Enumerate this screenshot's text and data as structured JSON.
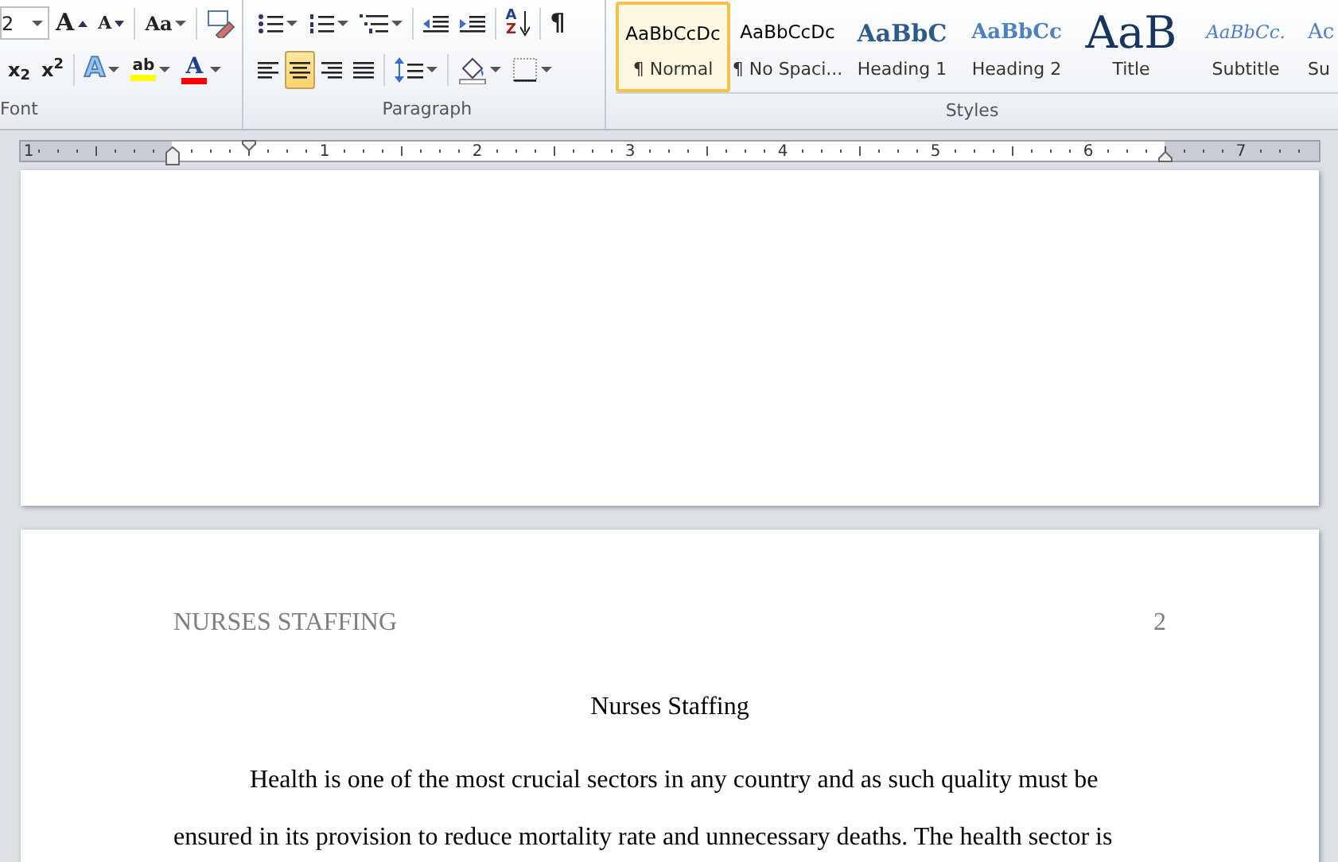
{
  "ribbon": {
    "font": {
      "label": "Font",
      "size": "2",
      "grow": "A",
      "shrink": "A",
      "change_case": "Aa",
      "subscript": "x$_{2}$",
      "superscript": "x$^{2}$",
      "text_effects": "A",
      "highlight": "ab",
      "font_color": "A"
    },
    "paragraph": {
      "label": "Paragraph",
      "sort_top": "A",
      "sort_bottom": "Z",
      "show_marks": "¶",
      "alignments": [
        {
          "selected": false
        },
        {
          "selected": true
        },
        {
          "selected": false
        },
        {
          "selected": false
        }
      ]
    },
    "styles": {
      "label": "Styles",
      "items": [
        {
          "kind": "normal",
          "preview": "AaBbCcDc",
          "name": "¶ Normal",
          "selected": true
        },
        {
          "kind": "normal",
          "preview": "AaBbCcDc",
          "name": "¶ No Spaci...",
          "selected": false
        },
        {
          "kind": "heading1",
          "preview": "AaBbC",
          "name": "Heading 1",
          "selected": false
        },
        {
          "kind": "heading2",
          "preview": "AaBbCc",
          "name": "Heading 2",
          "selected": false
        },
        {
          "kind": "title",
          "preview": "AaB",
          "name": "Title",
          "selected": false
        },
        {
          "kind": "subtitle",
          "preview": "AaBbCc.",
          "name": "Subtitle",
          "selected": false
        },
        {
          "kind": "cut",
          "preview": "Ac",
          "name": "Su",
          "selected": false
        }
      ]
    }
  },
  "ruler": {
    "numbers": [
      "1",
      "1",
      "2",
      "3",
      "4",
      "5",
      "6",
      "7"
    ]
  },
  "pages": [
    {
      "kind": "blank"
    },
    {
      "kind": "text",
      "header": "NURSES STAFFING",
      "page_number": "2",
      "title": "Nurses Staffing",
      "lines": [
        "Health is one of the most crucial sectors in any country and as such quality must be",
        "ensured in its provision to reduce mortality rate and unnecessary deaths. The health sector is"
      ]
    }
  ]
}
